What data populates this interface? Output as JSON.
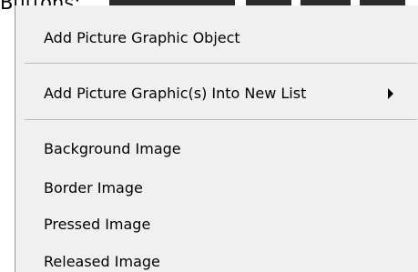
{
  "header": {
    "label": "Buttons:"
  },
  "menu": {
    "items": [
      {
        "label": "Add Picture Graphic Object"
      },
      {
        "label": "Add Picture Graphic(s) Into New List"
      },
      {
        "label": "Background Image"
      },
      {
        "label": "Border Image"
      },
      {
        "label": "Pressed Image"
      },
      {
        "label": "Released Image"
      }
    ]
  }
}
